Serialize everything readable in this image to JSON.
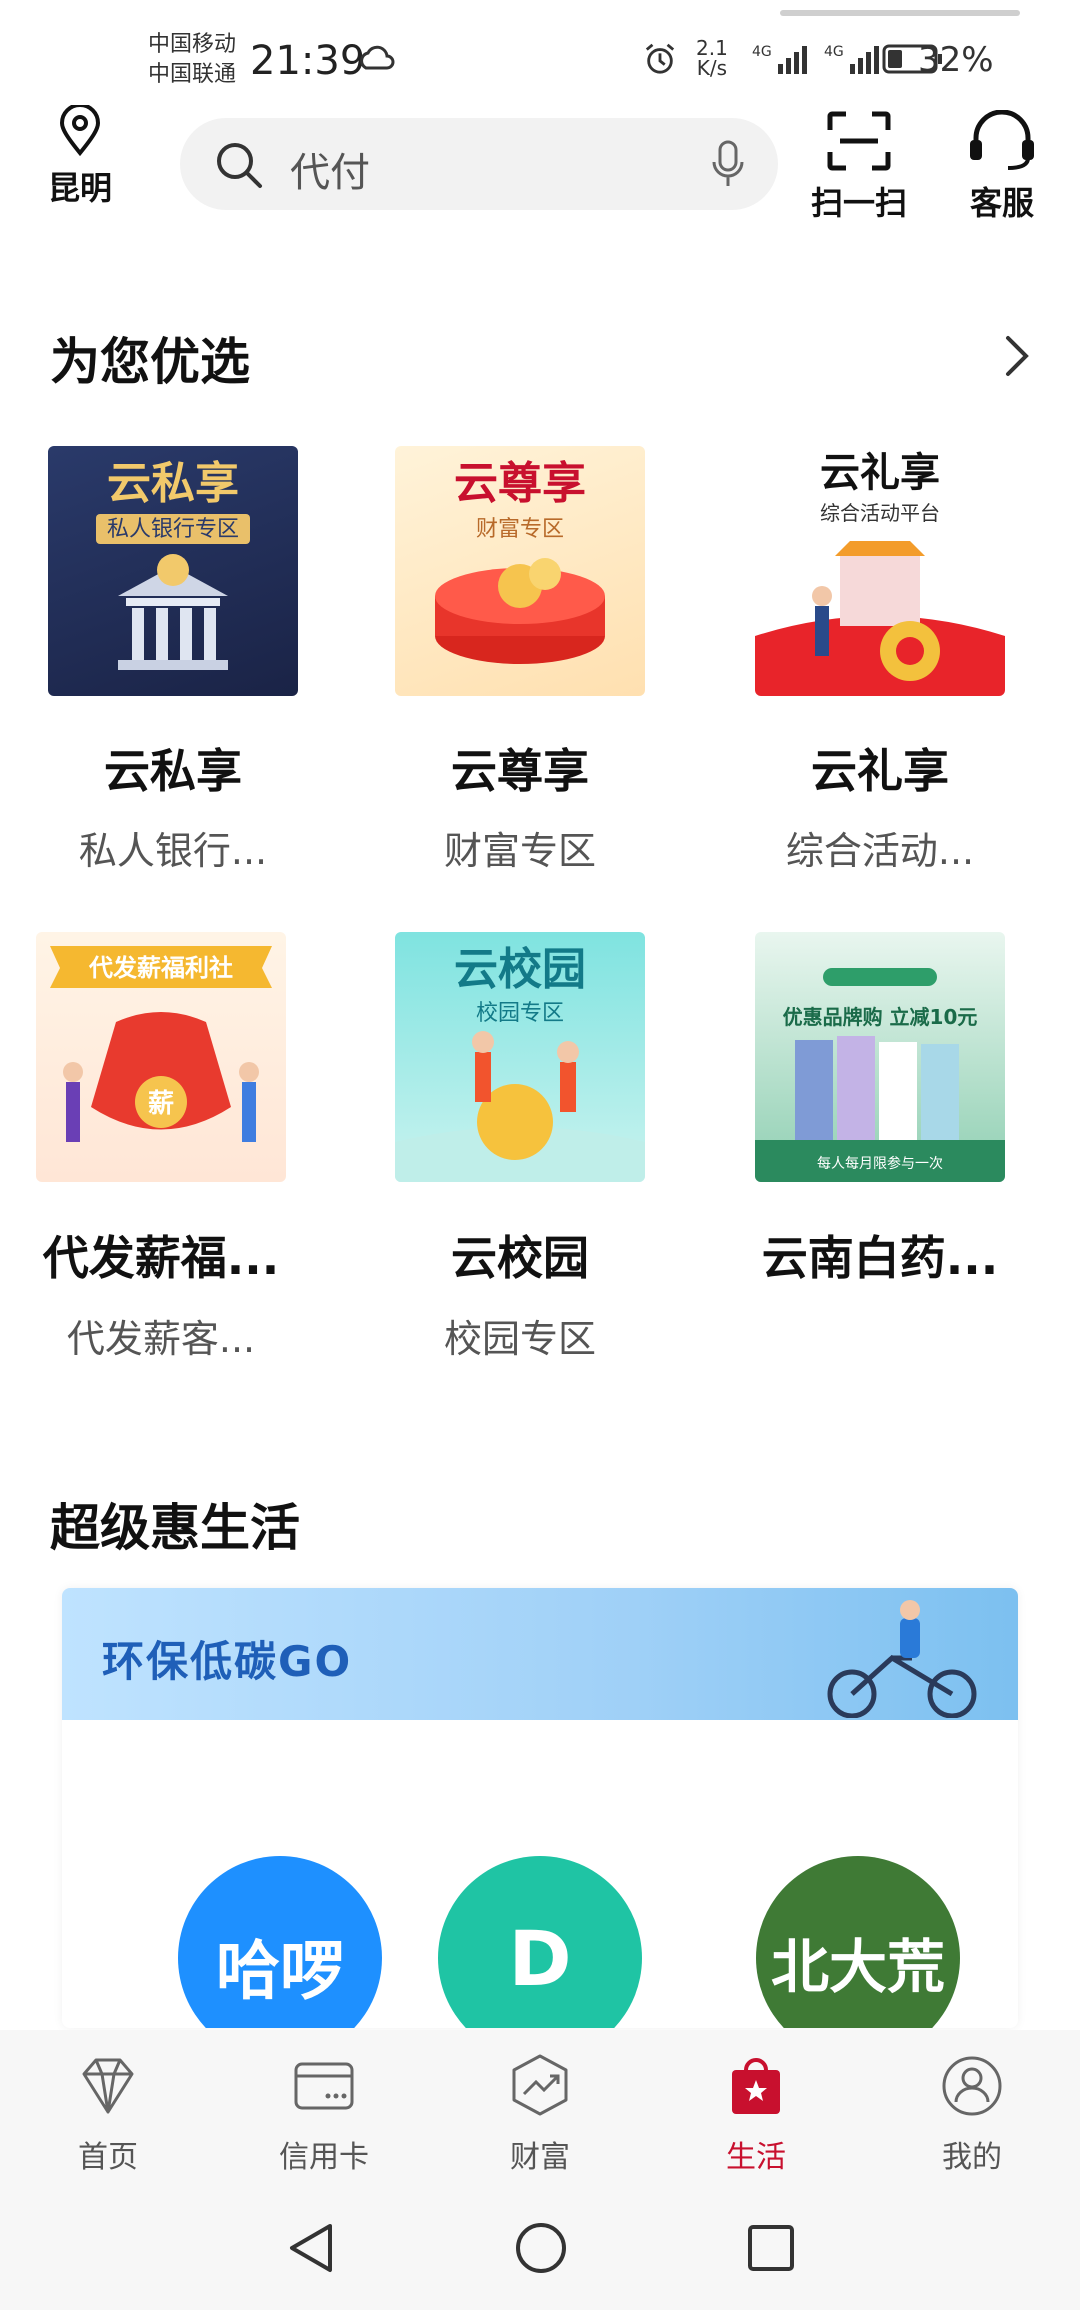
{
  "status": {
    "carrier1": "中国移动",
    "carrier2": "中国联通",
    "time": "21:39",
    "net_speed_value": "2.1",
    "net_speed_unit": "K/s",
    "battery": "32%"
  },
  "header": {
    "location": "昆明",
    "search_placeholder": "代付",
    "scan_label": "扫一扫",
    "service_label": "客服"
  },
  "featured": {
    "title": "为您优选",
    "items": [
      {
        "title": "云私享",
        "subtitle": "私人银行...",
        "image_title": "云私享",
        "image_sub": "私人银行专区"
      },
      {
        "title": "云尊享",
        "subtitle": "财富专区",
        "image_title": "云尊享",
        "image_sub": "财富专区"
      },
      {
        "title": "云礼享",
        "subtitle": "综合活动...",
        "image_title": "云礼享",
        "image_sub": "综合活动平台"
      },
      {
        "title": "代发薪福...",
        "subtitle": "代发薪客...",
        "image_title": "代发薪福利社",
        "image_sub": "薪"
      },
      {
        "title": "云校园",
        "subtitle": "校园专区",
        "image_title": "云校园",
        "image_sub": "校园专区"
      },
      {
        "title": "云南白药...",
        "subtitle": "",
        "image_title": "优惠品牌购 立减10元",
        "image_sub": "每人每月限参与一次"
      }
    ]
  },
  "life": {
    "title": "超级惠生活",
    "banner_text": "环保低碳GO",
    "brands": [
      {
        "name": "哈啰",
        "color": "#1e90ff"
      },
      {
        "name": "D",
        "color": "#1fc4a4"
      },
      {
        "name": "北大荒",
        "color": "#3f7a35"
      }
    ]
  },
  "tabbar": {
    "items": [
      {
        "label": "首页",
        "icon": "diamond-icon"
      },
      {
        "label": "信用卡",
        "icon": "credit-card-icon"
      },
      {
        "label": "财富",
        "icon": "wealth-icon"
      },
      {
        "label": "生活",
        "icon": "shopping-bag-icon"
      },
      {
        "label": "我的",
        "icon": "profile-icon"
      }
    ],
    "active_index": 3,
    "accent": "#c8102e"
  }
}
